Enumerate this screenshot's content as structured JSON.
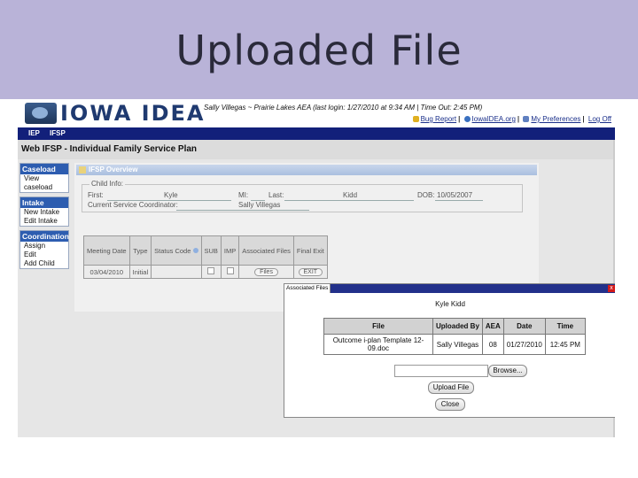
{
  "slide": {
    "title": "Uploaded File"
  },
  "app": {
    "logo_text": "IOWA IDEA",
    "user_info": "Sally Villegas ~ Prairie Lakes AEA   (last login: 1/27/2010 at 9:34 AM   |  Time Out: 2:45 PM)",
    "links": [
      "Bug Report",
      "IowaIDEA.org",
      "My Preferences",
      "Log Off"
    ],
    "nav": [
      "IEP",
      "IFSP"
    ],
    "subtitle": "Web IFSP - Individual Family Service Plan"
  },
  "sidebar": [
    {
      "head": "Caseload",
      "items": [
        "View caseload"
      ]
    },
    {
      "head": "Intake",
      "items": [
        "New Intake",
        "Edit Intake"
      ]
    },
    {
      "head": "Coordination",
      "items": [
        "Assign",
        "Edit",
        "Add Child"
      ]
    }
  ],
  "overview": {
    "title": "IFSP Overview",
    "child_info_legend": "Child Info:",
    "first_label": "First:",
    "first": "Kyle",
    "mi_label": "MI:",
    "last_label": "Last:",
    "last": "Kidd",
    "dob_label": "DOB:",
    "dob": "10/05/2007",
    "coordinator_label": "Current Service Coordinator:",
    "coordinator": "Sally Villegas"
  },
  "iep_table": {
    "headers": [
      "Meeting Date",
      "Type",
      "Status Code",
      "SUB",
      "IMP",
      "Associated Files",
      "Final Exit"
    ],
    "row": {
      "date": "03/04/2010",
      "type": "Initial",
      "files_btn": "Files",
      "exit_btn": "EXIT"
    }
  },
  "popup": {
    "title": "Associated Files",
    "name": "Kyle Kidd",
    "headers": [
      "File",
      "Uploaded By",
      "AEA",
      "Date",
      "Time"
    ],
    "rows": [
      [
        "Outcome i-plan Template 12-09.doc",
        "Sally Villegas",
        "08",
        "01/27/2010",
        "12:45 PM"
      ]
    ],
    "browse": "Browse...",
    "upload": "Upload File",
    "close": "Close"
  }
}
